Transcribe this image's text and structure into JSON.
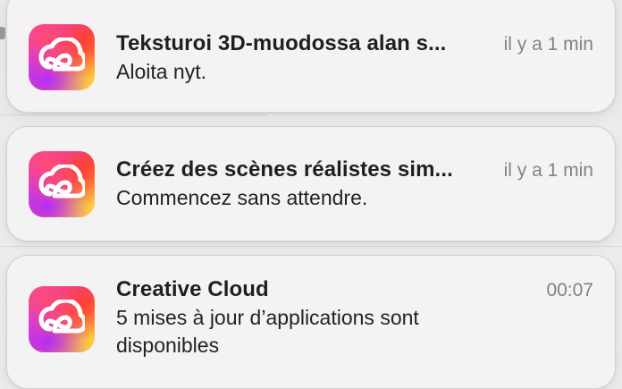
{
  "notifications": [
    {
      "app_icon": "adobe-creative-cloud-icon",
      "title": "Teksturoi 3D-muodossa alan s...",
      "time": "il y a 1 min",
      "body": "Aloita nyt."
    },
    {
      "app_icon": "adobe-creative-cloud-icon",
      "title": "Créez des scènes réalistes sim...",
      "time": "il y a 1 min",
      "body": "Commencez sans attendre."
    },
    {
      "app_icon": "adobe-creative-cloud-icon",
      "title": "Creative Cloud",
      "time": "00:07",
      "body": "5 mises à jour d’applications sont disponibles"
    }
  ],
  "colors": {
    "background": "#eceaea",
    "card": "#f4f2f2",
    "title": "#1f1f1f",
    "body": "#232323",
    "time": "#858181"
  }
}
